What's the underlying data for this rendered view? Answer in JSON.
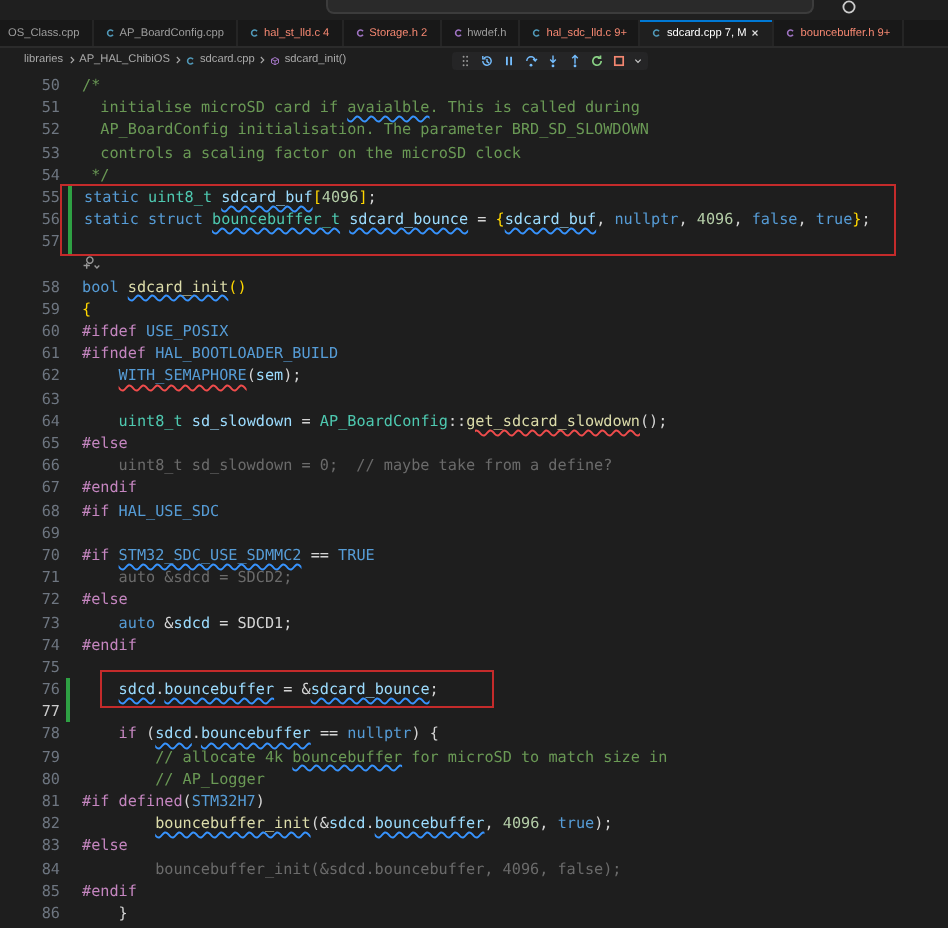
{
  "tabs": [
    {
      "label": "OS_Class.cpp",
      "has_problems": false,
      "selected": false
    },
    {
      "label": "AP_BoardConfig.cpp",
      "color": "#519aba",
      "has_problems": false,
      "selected": false
    },
    {
      "label": "hal_st_lld.c 4",
      "color": "#519aba",
      "has_problems": true,
      "selected": false
    },
    {
      "label": "Storage.h 2",
      "color": "#a074c4",
      "has_problems": true,
      "selected": false
    },
    {
      "label": "hwdef.h",
      "color": "#a074c4",
      "has_problems": false,
      "selected": false
    },
    {
      "label": "hal_sdc_lld.c 9+",
      "color": "#519aba",
      "has_problems": true,
      "selected": false
    },
    {
      "label": "sdcard.cpp 7, M",
      "color": "#519aba",
      "has_problems": true,
      "selected": true
    },
    {
      "label": "bouncebuffer.h 9+",
      "color": "#a074c4",
      "has_problems": true,
      "selected": false
    }
  ],
  "breadcrumb": [
    {
      "label": "libraries",
      "kind": "folder"
    },
    {
      "label": "AP_HAL_ChibiOS",
      "kind": "folder"
    },
    {
      "label": "sdcard.cpp",
      "kind": "file"
    },
    {
      "label": "sdcard_init()",
      "kind": "symbol"
    }
  ],
  "lines": [
    {
      "kind": "code",
      "number": "50",
      "tokens": [
        {
          "kind": "cm",
          "text": "/*"
        }
      ]
    },
    {
      "kind": "code",
      "number": "51",
      "tokens": [
        {
          "kind": "cm",
          "text": "  initialise microSD card if "
        },
        {
          "kind": "cm",
          "text": "avaialble",
          "hint": true
        },
        {
          "kind": "cm",
          "text": ". This is called during"
        }
      ]
    },
    {
      "kind": "code",
      "number": "52",
      "tokens": [
        {
          "kind": "cm",
          "text": "  AP_BoardConfig initialisation. The parameter BRD_SD_SLOWDOWN"
        }
      ]
    },
    {
      "kind": "code",
      "number": "53",
      "tokens": [
        {
          "kind": "cm",
          "text": "  controls a scaling factor on the microSD clock"
        }
      ]
    },
    {
      "kind": "code",
      "number": "54",
      "tokens": [
        {
          "kind": "cm",
          "text": " */"
        }
      ]
    },
    {
      "kind": "boxed_block",
      "number": "55",
      "modified": true,
      "tokens": [
        {
          "kind": "kw",
          "text": "static "
        },
        {
          "kind": "type",
          "text": "uint8_t "
        },
        {
          "kind": "var",
          "text": "sdcard_buf",
          "hint": true
        },
        {
          "kind": "brace",
          "text": "["
        },
        {
          "kind": "num",
          "text": "4096"
        },
        {
          "kind": "brace",
          "text": "]"
        },
        {
          "kind": "plain",
          "text": ";"
        }
      ]
    },
    {
      "kind": "boxed_block",
      "number": "56",
      "modified": true,
      "tokens": [
        {
          "kind": "kw",
          "text": "static struct "
        },
        {
          "kind": "type",
          "text": "bouncebuffer_t ",
          "hint": true
        },
        {
          "kind": "var",
          "text": "sdcard_bounce",
          "hint": true
        },
        {
          "kind": "plain",
          "text": " = "
        },
        {
          "kind": "brace",
          "text": "{"
        },
        {
          "kind": "var",
          "text": "sdcard_buf",
          "hint": true
        },
        {
          "kind": "plain",
          "text": ", "
        },
        {
          "kind": "kw",
          "text": "nullptr"
        },
        {
          "kind": "plain",
          "text": ", "
        },
        {
          "kind": "num",
          "text": "4096"
        },
        {
          "kind": "plain",
          "text": ", "
        },
        {
          "kind": "kw",
          "text": "false"
        },
        {
          "kind": "plain",
          "text": ", "
        },
        {
          "kind": "kw",
          "text": "true"
        },
        {
          "kind": "brace",
          "text": "}"
        },
        {
          "kind": "plain",
          "text": ";"
        }
      ]
    },
    {
      "kind": "boxed_block",
      "number": "57",
      "modified": true
    },
    {
      "kind": "codelens"
    },
    {
      "kind": "code",
      "number": "58",
      "tokens": [
        {
          "kind": "kw",
          "text": "bool "
        },
        {
          "kind": "fn",
          "text": "sdcard_init",
          "hint": true
        },
        {
          "kind": "brace",
          "text": "()"
        }
      ]
    },
    {
      "kind": "code",
      "number": "59",
      "tokens": [
        {
          "kind": "brace",
          "text": "{"
        }
      ]
    },
    {
      "kind": "code",
      "number": "60",
      "tokens": [
        {
          "kind": "pp",
          "text": "#ifdef "
        },
        {
          "kind": "macro",
          "text": "USE_POSIX"
        }
      ]
    },
    {
      "kind": "code",
      "number": "61",
      "tokens": [
        {
          "kind": "pp",
          "text": "#ifndef "
        },
        {
          "kind": "macro",
          "text": "HAL_BOOTLOADER_BUILD"
        }
      ]
    },
    {
      "kind": "code",
      "number": "62",
      "tokens": [
        {
          "kind": "macro",
          "text": "    WITH_SEMAPHORE",
          "error": true
        },
        {
          "kind": "plain",
          "text": "("
        },
        {
          "kind": "var",
          "text": "sem"
        },
        {
          "kind": "plain",
          "text": ");"
        }
      ]
    },
    {
      "kind": "code",
      "number": "63"
    },
    {
      "kind": "code",
      "number": "64",
      "tokens": [
        {
          "kind": "type",
          "text": "    uint8_t "
        },
        {
          "kind": "var",
          "text": "sd_slowdown"
        },
        {
          "kind": "plain",
          "text": " = "
        },
        {
          "kind": "type",
          "text": "AP_BoardConfig"
        },
        {
          "kind": "plain",
          "text": "::"
        },
        {
          "kind": "fn",
          "text": "get_sdcard_slowdown",
          "error": true
        },
        {
          "kind": "plain",
          "text": "();"
        }
      ]
    },
    {
      "kind": "code",
      "number": "65",
      "tokens": [
        {
          "kind": "pp",
          "text": "#else"
        }
      ]
    },
    {
      "kind": "code",
      "number": "66",
      "tokens": [
        {
          "kind": "dim",
          "text": "    uint8_t sd_slowdown = 0;  // maybe take from a define?"
        }
      ]
    },
    {
      "kind": "code",
      "number": "67",
      "tokens": [
        {
          "kind": "pp",
          "text": "#endif"
        }
      ]
    },
    {
      "kind": "code",
      "number": "68",
      "tokens": [
        {
          "kind": "pp",
          "text": "#if "
        },
        {
          "kind": "macro",
          "text": "HAL_USE_SDC"
        }
      ]
    },
    {
      "kind": "code",
      "number": "69"
    },
    {
      "kind": "code",
      "number": "70",
      "tokens": [
        {
          "kind": "pp",
          "text": "#if "
        },
        {
          "kind": "macro",
          "text": "STM32_SDC_USE_SDMMC2",
          "hint": true
        },
        {
          "kind": "plain",
          "text": " == "
        },
        {
          "kind": "macro",
          "text": "TRUE"
        }
      ]
    },
    {
      "kind": "code",
      "number": "71",
      "tokens": [
        {
          "kind": "dim",
          "text": "    auto &sdcd = SDCD2;"
        }
      ]
    },
    {
      "kind": "code",
      "number": "72",
      "tokens": [
        {
          "kind": "pp",
          "text": "#else"
        }
      ]
    },
    {
      "kind": "code",
      "number": "73",
      "tokens": [
        {
          "kind": "kw",
          "text": "    auto "
        },
        {
          "kind": "plain",
          "text": "&"
        },
        {
          "kind": "var",
          "text": "sdcd"
        },
        {
          "kind": "plain",
          "text": " = SDCD1;"
        }
      ]
    },
    {
      "kind": "code",
      "number": "74",
      "tokens": [
        {
          "kind": "pp",
          "text": "#endif"
        }
      ]
    },
    {
      "kind": "code",
      "number": "75"
    },
    {
      "kind": "boxed_inline",
      "number": "76",
      "modified": true,
      "tokens": [
        {
          "kind": "var",
          "text": "    sdcd",
          "hint": true
        },
        {
          "kind": "plain",
          "text": "."
        },
        {
          "kind": "var",
          "text": "bouncebuffer",
          "hint": true
        },
        {
          "kind": "plain",
          "text": " = &"
        },
        {
          "kind": "var",
          "text": "sdcard_bounce",
          "hint": true
        },
        {
          "kind": "plain",
          "text": ";"
        }
      ]
    },
    {
      "kind": "code",
      "number": "77",
      "modified": true,
      "current": true
    },
    {
      "kind": "code",
      "number": "78",
      "tokens": [
        {
          "kind": "ctl",
          "text": "    if"
        },
        {
          "kind": "plain",
          "text": " ("
        },
        {
          "kind": "var",
          "text": "sdcd",
          "hint": true
        },
        {
          "kind": "plain",
          "text": "."
        },
        {
          "kind": "var",
          "text": "bouncebuffer",
          "hint": true
        },
        {
          "kind": "plain",
          "text": " == "
        },
        {
          "kind": "kw",
          "text": "nullptr"
        },
        {
          "kind": "plain",
          "text": ") {"
        }
      ]
    },
    {
      "kind": "code",
      "number": "79",
      "tokens": [
        {
          "kind": "cm",
          "text": "        // allocate 4k "
        },
        {
          "kind": "cm",
          "text": "bouncebuffer",
          "hint": true
        },
        {
          "kind": "cm",
          "text": " for microSD to match size in"
        }
      ]
    },
    {
      "kind": "code",
      "number": "80",
      "tokens": [
        {
          "kind": "cm",
          "text": "        // AP_Logger"
        }
      ]
    },
    {
      "kind": "code",
      "number": "81",
      "tokens": [
        {
          "kind": "pp",
          "text": "#if defined"
        },
        {
          "kind": "plain",
          "text": "("
        },
        {
          "kind": "macro",
          "text": "STM32H7"
        },
        {
          "kind": "plain",
          "text": ")"
        }
      ]
    },
    {
      "kind": "code",
      "number": "82",
      "tokens": [
        {
          "kind": "fn",
          "text": "        bouncebuffer_init",
          "hint": true
        },
        {
          "kind": "plain",
          "text": "(&"
        },
        {
          "kind": "var",
          "text": "sdcd"
        },
        {
          "kind": "plain",
          "text": "."
        },
        {
          "kind": "var",
          "text": "bouncebuffer",
          "hint": true
        },
        {
          "kind": "plain",
          "text": ", "
        },
        {
          "kind": "num",
          "text": "4096"
        },
        {
          "kind": "plain",
          "text": ", "
        },
        {
          "kind": "kw",
          "text": "true"
        },
        {
          "kind": "plain",
          "text": ");"
        }
      ]
    },
    {
      "kind": "code",
      "number": "83",
      "tokens": [
        {
          "kind": "pp",
          "text": "#else"
        }
      ]
    },
    {
      "kind": "code",
      "number": "84",
      "tokens": [
        {
          "kind": "dim",
          "text": "        bouncebuffer_init(&sdcd.bouncebuffer, 4096, false);"
        }
      ]
    },
    {
      "kind": "code",
      "number": "85",
      "tokens": [
        {
          "kind": "pp",
          "text": "#endif"
        }
      ]
    },
    {
      "kind": "code",
      "number": "86",
      "tokens": [
        {
          "kind": "plain",
          "text": "    }"
        }
      ]
    }
  ]
}
